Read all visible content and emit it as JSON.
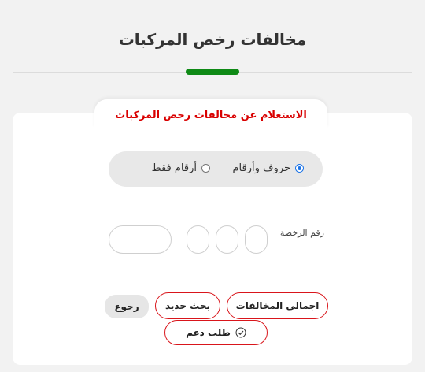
{
  "header": {
    "title": "مخالفات رخص المركبات"
  },
  "card": {
    "title": "الاستعلام عن مخالفات رخص المركبات",
    "radio_options": [
      {
        "label": "حروف وأرقام",
        "checked": true
      },
      {
        "label": "أرقام فقط",
        "checked": false
      }
    ],
    "license_label": "رقم الرخصة",
    "buttons": {
      "total": "اجمالي المخالفات",
      "new_search": "بحث جديد",
      "back": "رجوع",
      "support": "طلب دعم"
    }
  },
  "colors": {
    "accent_green": "#0f8a16",
    "alert_red": "#d90000",
    "button_border": "#d9151b"
  },
  "icons": [
    "radio-checked-icon",
    "radio-unchecked-icon",
    "check-circle-icon"
  ]
}
